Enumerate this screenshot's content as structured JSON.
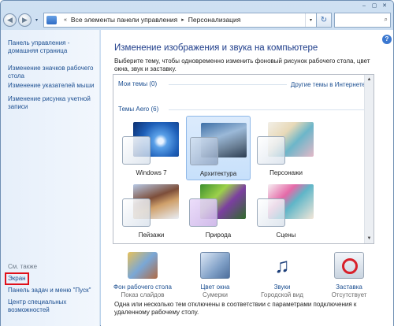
{
  "window": {
    "min": "–",
    "max": "▢",
    "close": "✕"
  },
  "address": {
    "part1": "Все элементы панели управления",
    "part2": "Персонализация",
    "dropdown": "▾",
    "refresh": "↻",
    "search_icon": "⌕"
  },
  "sidebar": {
    "items": [
      {
        "label": "Панель управления - домашняя страница"
      },
      {
        "label": "Изменение значков рабочего стола"
      },
      {
        "label": "Изменение указателей мыши"
      },
      {
        "label": "Изменение рисунка учетной записи"
      }
    ],
    "see_also": "См. также",
    "links": [
      {
        "label": "Экран"
      },
      {
        "label": "Панель задач и меню \"Пуск\""
      },
      {
        "label": "Центр специальных возможностей"
      }
    ]
  },
  "main": {
    "title": "Изменение изображения и звука на компьютере",
    "description": "Выберите тему, чтобы одновременно изменить фоновый рисунок рабочего стола, цвет окна, звук и заставку.",
    "my_themes": "Мои темы (0)",
    "online_link": "Другие темы в Интернете",
    "aero_themes": "Темы Aero (6)",
    "themes": [
      {
        "label": "Windows 7"
      },
      {
        "label": "Архитектура"
      },
      {
        "label": "Персонажи"
      },
      {
        "label": "Пейзажи"
      },
      {
        "label": "Природа"
      },
      {
        "label": "Сцены"
      }
    ],
    "options": [
      {
        "label": "Фон рабочего стола",
        "value": "Показ слайдов"
      },
      {
        "label": "Цвет окна",
        "value": "Сумерки"
      },
      {
        "label": "Звуки",
        "value": "Городской вид"
      },
      {
        "label": "Заставка",
        "value": "Отсутствует"
      }
    ],
    "footer": "Одна или несколько тем отключены в соответствии с параметрами подключения к удаленному рабочему столу."
  },
  "colors": {
    "accent": "#1c4f91",
    "title": "#1e3d8a",
    "selection": "#c7e0fb",
    "highlight": "#e0101a"
  }
}
